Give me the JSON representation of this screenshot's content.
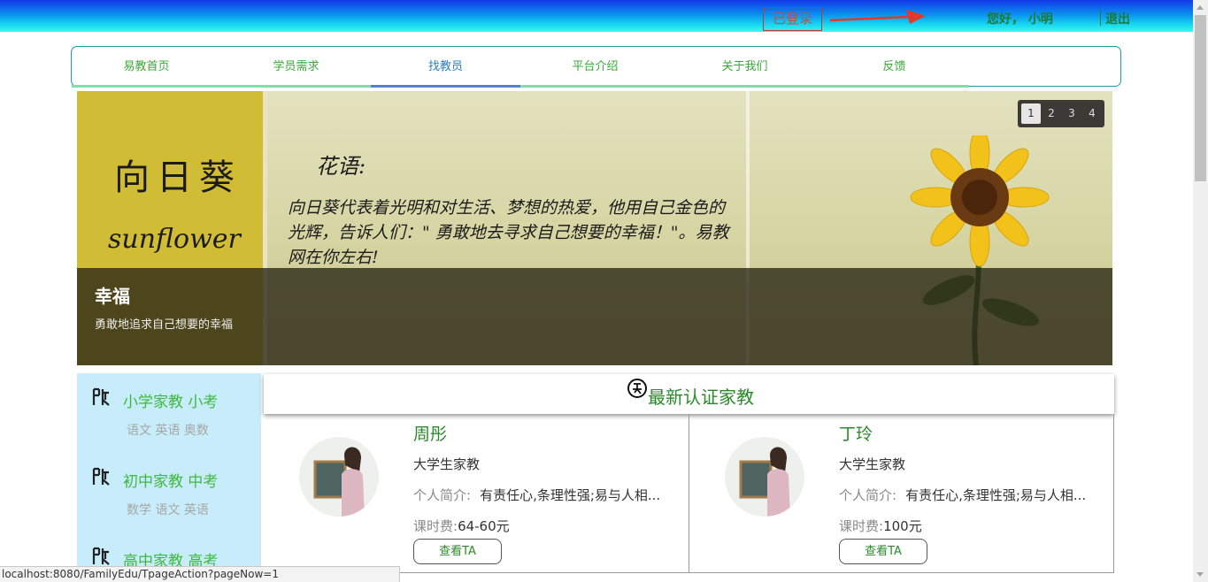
{
  "header": {
    "logged_in": "已登录",
    "greeting": "您好，  小明",
    "logout": "退出"
  },
  "nav": {
    "items": [
      {
        "label": "易教首页"
      },
      {
        "label": "学员需求"
      },
      {
        "label": "找教员"
      },
      {
        "label": "平台介绍"
      },
      {
        "label": "关于我们"
      },
      {
        "label": "反馈"
      }
    ],
    "active_index": 2
  },
  "banner": {
    "title_zh": "向日葵",
    "title_en": "sunflower",
    "huayu": "花语:",
    "text": "向日葵代表着光明和对生活、梦想的热爱，他用自己金色的光辉，告诉人们：\" 勇敢地去寻求自己想要的幸福！\"。易教网在你左右!",
    "slide_title": "幸福",
    "slide_desc": "勇敢地追求自己想要的幸福",
    "pages": [
      "1",
      "2",
      "3",
      "4"
    ],
    "active_page": "1"
  },
  "sidebar": {
    "categories": [
      {
        "title": "小学家教 小考",
        "sub": "语文 英语 奥数"
      },
      {
        "title": "初中家教 中考",
        "sub": "数学 语文 英语"
      },
      {
        "title": "高中家教 高考",
        "sub": ""
      }
    ]
  },
  "main": {
    "title": "最新认证家教",
    "teachers": [
      {
        "name": "周彤",
        "role": "大学生家教",
        "intro_label": "个人简介:",
        "intro": "有责任心,条理性强;易与人相...",
        "fee_label": "课时费:",
        "fee": "64-60元",
        "button": "查看TA"
      },
      {
        "name": "丁玲",
        "role": "大学生家教",
        "intro_label": "个人简介:",
        "intro": "有责任心,条理性强;易与人相...",
        "fee_label": "课时费:",
        "fee": "100元",
        "button": "查看TA"
      }
    ]
  },
  "status_url": "localhost:8080/FamilyEdu/TpageAction?pageNow=1",
  "colors": {
    "accent_green": "#39a839",
    "nav_active": "#4d86c4",
    "sidebar_bg": "#c7ecfa"
  }
}
